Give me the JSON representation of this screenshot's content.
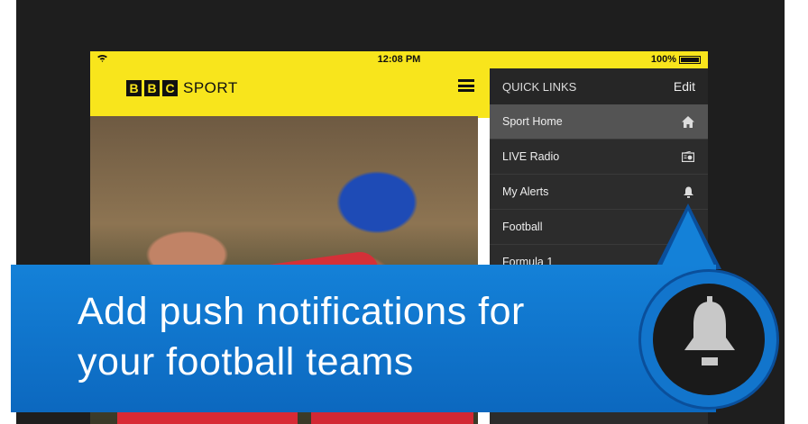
{
  "status_bar": {
    "time": "12:08 PM",
    "battery": "100%"
  },
  "brand": {
    "letters": [
      "B",
      "B",
      "C"
    ],
    "word": "SPORT"
  },
  "quick_links": {
    "title": "QUICK LINKS",
    "edit_label": "Edit",
    "items": [
      {
        "label": "Sport Home",
        "icon": "home-icon"
      },
      {
        "label": "LIVE Radio",
        "icon": "radio-icon"
      },
      {
        "label": "My Alerts",
        "icon": "bell-icon"
      },
      {
        "label": "Football",
        "icon": ""
      },
      {
        "label": "Formula 1",
        "icon": ""
      }
    ]
  },
  "banner": {
    "line1": "Add push notifications for",
    "line2": "your football teams",
    "icon": "bell-icon"
  },
  "colors": {
    "brand_yellow": "#f8e51c",
    "banner_blue": "#1481d8",
    "panel_dark": "#2c2c2c"
  }
}
